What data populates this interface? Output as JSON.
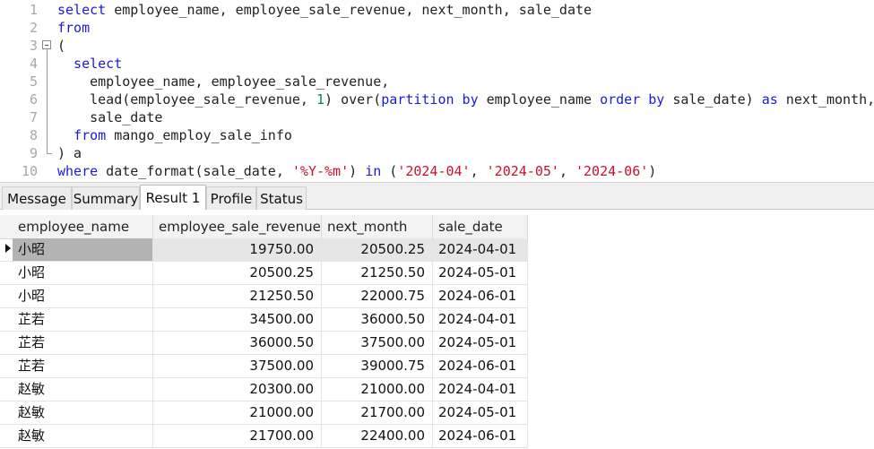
{
  "editor": {
    "lines": [
      {
        "n": "1",
        "tokens": [
          {
            "t": "select",
            "c": "kw"
          },
          {
            "t": " employee_name, employee_sale_revenue, next_month, sale_date",
            "c": "fn"
          }
        ]
      },
      {
        "n": "2",
        "tokens": [
          {
            "t": "from",
            "c": "kw"
          }
        ]
      },
      {
        "n": "3",
        "tokens": [
          {
            "t": "(",
            "c": "fn"
          }
        ]
      },
      {
        "n": "4",
        "tokens": [
          {
            "t": "  select",
            "c": "kw"
          }
        ]
      },
      {
        "n": "5",
        "tokens": [
          {
            "t": "    employee_name, employee_sale_revenue,",
            "c": "fn"
          }
        ]
      },
      {
        "n": "6",
        "tokens": [
          {
            "t": "    lead(employee_sale_revenue, ",
            "c": "fn"
          },
          {
            "t": "1",
            "c": "num"
          },
          {
            "t": ") over(",
            "c": "fn"
          },
          {
            "t": "partition by",
            "c": "kw"
          },
          {
            "t": " employee_name ",
            "c": "fn"
          },
          {
            "t": "order by",
            "c": "kw"
          },
          {
            "t": " sale_date) ",
            "c": "fn"
          },
          {
            "t": "as",
            "c": "kw"
          },
          {
            "t": " next_month,",
            "c": "fn"
          }
        ]
      },
      {
        "n": "7",
        "tokens": [
          {
            "t": "    sale_date",
            "c": "fn"
          }
        ]
      },
      {
        "n": "8",
        "tokens": [
          {
            "t": "  ",
            "c": "fn"
          },
          {
            "t": "from",
            "c": "kw"
          },
          {
            "t": " mango_employ_sale_info",
            "c": "fn"
          }
        ]
      },
      {
        "n": "9",
        "tokens": [
          {
            "t": ") a",
            "c": "fn"
          }
        ]
      },
      {
        "n": "10",
        "tokens": [
          {
            "t": "where",
            "c": "kw"
          },
          {
            "t": " date_format(sale_date, ",
            "c": "fn"
          },
          {
            "t": "'%Y-%m'",
            "c": "str"
          },
          {
            "t": ") ",
            "c": "fn"
          },
          {
            "t": "in",
            "c": "kw"
          },
          {
            "t": " (",
            "c": "fn"
          },
          {
            "t": "'2024-04'",
            "c": "str"
          },
          {
            "t": ", ",
            "c": "fn"
          },
          {
            "t": "'2024-05'",
            "c": "str"
          },
          {
            "t": ", ",
            "c": "fn"
          },
          {
            "t": "'2024-06'",
            "c": "str"
          },
          {
            "t": ")",
            "c": "fn"
          }
        ]
      }
    ]
  },
  "tabs": [
    {
      "label": "Message",
      "active": false
    },
    {
      "label": "Summary",
      "active": false
    },
    {
      "label": "Result 1",
      "active": true
    },
    {
      "label": "Profile",
      "active": false
    },
    {
      "label": "Status",
      "active": false
    }
  ],
  "results": {
    "columns": [
      "employee_name",
      "employee_sale_revenue",
      "next_month",
      "sale_date"
    ],
    "rows": [
      [
        "小昭",
        "19750.00",
        "20500.25",
        "2024-04-01"
      ],
      [
        "小昭",
        "20500.25",
        "21250.50",
        "2024-05-01"
      ],
      [
        "小昭",
        "21250.50",
        "22000.75",
        "2024-06-01"
      ],
      [
        "芷若",
        "34500.00",
        "36000.50",
        "2024-04-01"
      ],
      [
        "芷若",
        "36000.50",
        "37500.00",
        "2024-05-01"
      ],
      [
        "芷若",
        "37500.00",
        "39000.75",
        "2024-06-01"
      ],
      [
        "赵敏",
        "20300.00",
        "21000.00",
        "2024-04-01"
      ],
      [
        "赵敏",
        "21000.00",
        "21700.00",
        "2024-05-01"
      ],
      [
        "赵敏",
        "21700.00",
        "22400.00",
        "2024-06-01"
      ]
    ],
    "selected_row": 0
  }
}
